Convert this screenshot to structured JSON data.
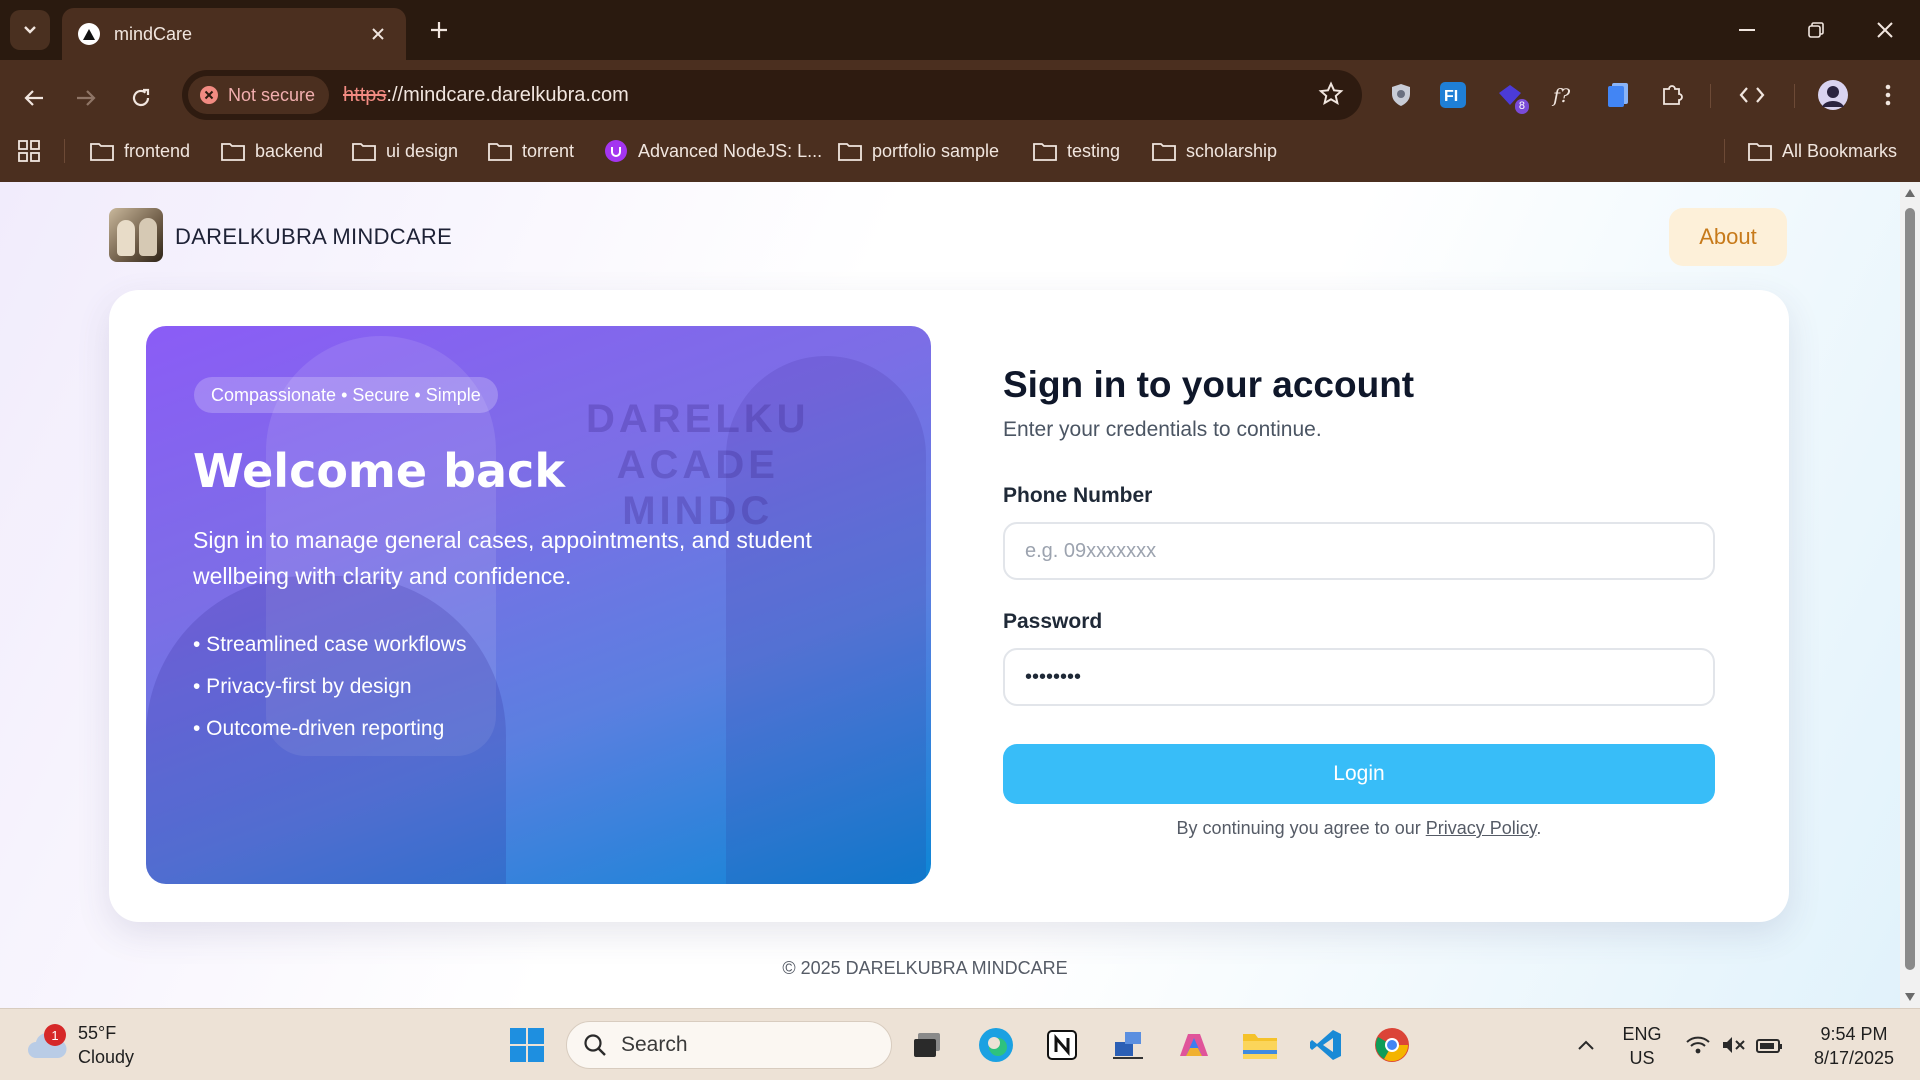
{
  "browser": {
    "tab_title": "mindCare",
    "security_label": "Not secure",
    "url_scheme": "https",
    "url_rest": "://mindcare.darelkubra.com",
    "extension_badge": "8",
    "bookmarks": [
      "frontend",
      "backend",
      "ui design",
      "torrent",
      "Advanced NodeJS: L...",
      "portfolio sample",
      "testing",
      "scholarship"
    ],
    "all_bookmarks": "All Bookmarks"
  },
  "site": {
    "brand": "DARELKUBRA MINDCARE",
    "about_label": "About",
    "footer": "© 2025 DARELKUBRA MINDCARE"
  },
  "hero": {
    "chip": "Compassionate • Secure • Simple",
    "title": "Welcome back",
    "subtitle": "Sign in to manage general cases, appointments, and student wellbeing with clarity and confidence.",
    "features": [
      "• Streamlined case workflows",
      "• Privacy-first by design",
      "• Outcome-driven reporting"
    ],
    "watermark_line1": "DARELKU",
    "watermark_line2": "ACADE",
    "watermark_line3": "MINDC"
  },
  "signin": {
    "title": "Sign in to your account",
    "subtitle": "Enter your credentials to continue.",
    "phone_label": "Phone Number",
    "phone_placeholder": "e.g. 09xxxxxxx",
    "password_label": "Password",
    "password_value": "••••••••",
    "login_label": "Login",
    "agree_prefix": "By continuing you agree to our ",
    "privacy_link": "Privacy Policy",
    "agree_suffix": "."
  },
  "taskbar": {
    "weather_alert": "1",
    "temperature": "55°F",
    "condition": "Cloudy",
    "search_label": "Search",
    "language_line1": "ENG",
    "language_line2": "US",
    "time": "9:54 PM",
    "date": "8/17/2025"
  },
  "colors": {
    "accent_login": "#38bdf8",
    "about_text": "#c77a1a",
    "hero_gradient_start": "#8b5cf6",
    "hero_gradient_end": "#0d86d6"
  }
}
